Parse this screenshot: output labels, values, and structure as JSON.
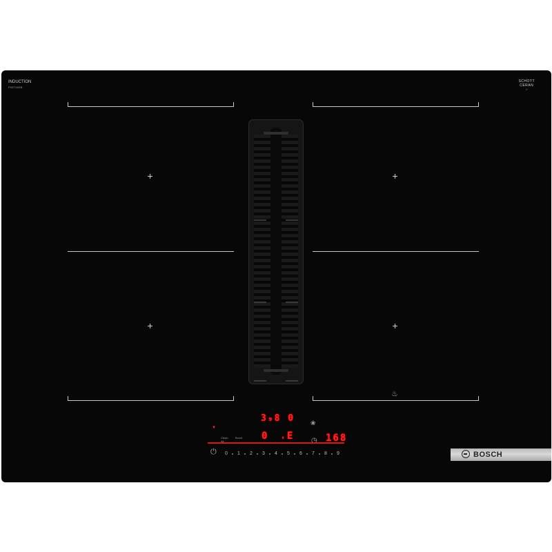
{
  "product": {
    "left_label": "INDUCTION",
    "left_sublabel": "PXE71KEB",
    "glass_logo_top": "SCHOTT",
    "glass_logo_main": "CERAN",
    "glass_logo_sub": "®"
  },
  "display": {
    "top_readout": "3₉8 0",
    "left_level": "0",
    "center_level": "E",
    "timer_value": "168",
    "power_level_sub": "₉"
  },
  "controls": {
    "scale": [
      "0",
      "1",
      "2",
      "3",
      "4",
      "5",
      "6",
      "7",
      "8",
      "9"
    ],
    "power_icon": "power-icon",
    "timer_icon": "clock-icon",
    "fan_icon": "fan-icon",
    "tiny_labels": [
      "Clean Air",
      "Boost"
    ]
  },
  "brand": {
    "name": "BOSCH"
  },
  "colors": {
    "glass": "#070707",
    "display_red": "#ff2424",
    "zone_lines": "#c9c9c9",
    "plate": "#c4c4c4"
  }
}
